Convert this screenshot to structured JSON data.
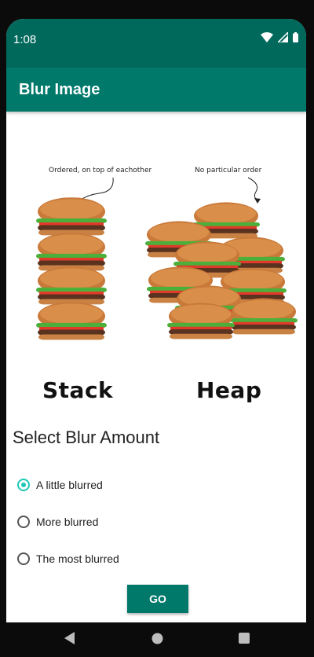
{
  "status_bar": {
    "time": "1:08",
    "icons": [
      "wifi-icon",
      "signal-icon",
      "battery-icon"
    ]
  },
  "app_bar": {
    "title": "Blur Image",
    "color": "#00796b"
  },
  "image": {
    "left_caption": "Ordered, on top of eachother",
    "right_caption": "No particular order",
    "left_label": "Stack",
    "right_label": "Heap"
  },
  "blur_section": {
    "title": "Select Blur Amount",
    "options": [
      {
        "label": "A little blurred",
        "selected": true
      },
      {
        "label": "More blurred",
        "selected": false
      },
      {
        "label": "The most blurred",
        "selected": false
      }
    ]
  },
  "go_button": {
    "label": "GO"
  },
  "nav_bar": {
    "icons": [
      "back-icon",
      "home-icon",
      "recents-icon"
    ]
  },
  "colors": {
    "accent": "#1ec8b8",
    "primary": "#00796b",
    "primary_dark": "#00695c"
  }
}
